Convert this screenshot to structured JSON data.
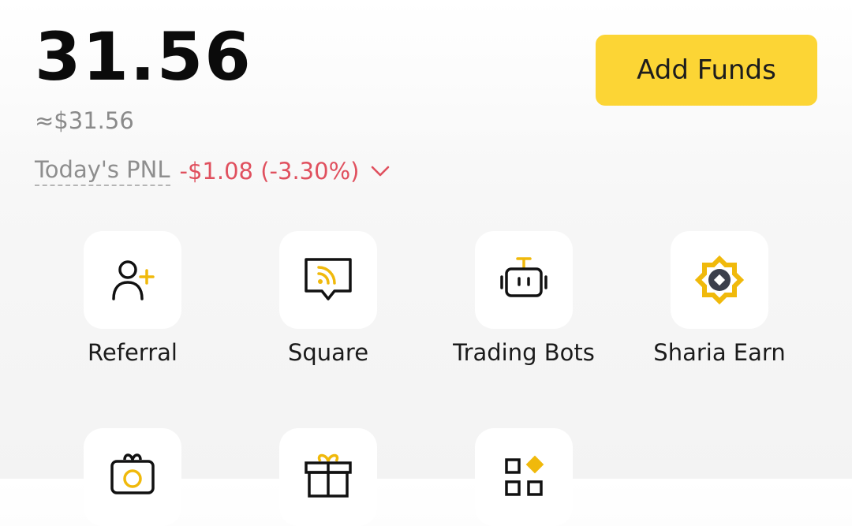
{
  "balance": {
    "amount": "31.56",
    "fiat_equivalent": "≈$31.56",
    "pnl_label": "Today's PNL",
    "pnl_value": "-$1.08 (-3.30%)",
    "pnl_color": "#e0505e"
  },
  "actions": {
    "add_funds_label": "Add Funds",
    "accent_color": "#fcd535"
  },
  "shortcuts": [
    {
      "label": "Referral",
      "icon": "add-user-icon"
    },
    {
      "label": "Square",
      "icon": "square-feed-icon"
    },
    {
      "label": "Trading Bots",
      "icon": "robot-icon"
    },
    {
      "label": "Sharia Earn",
      "icon": "sharia-earn-icon"
    },
    {
      "label": "",
      "icon": "gift-camera-icon"
    },
    {
      "label": "",
      "icon": "gift-box-icon"
    },
    {
      "label": "",
      "icon": "more-apps-icon"
    }
  ]
}
